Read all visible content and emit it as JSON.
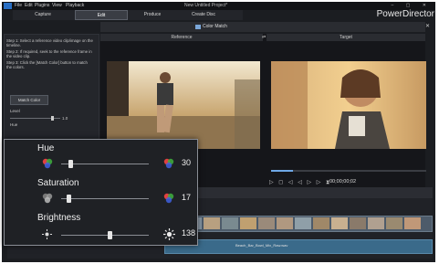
{
  "window": {
    "title": "New Untitled Project*",
    "brand": "PowerDirector",
    "controls": "– ▢ ✕"
  },
  "menu": [
    "File",
    "Edit",
    "Plugins",
    "View",
    "Playback"
  ],
  "tabs": [
    "Capture",
    "Edit",
    "Produce",
    "Create Disc"
  ],
  "dialog": {
    "title": "Color Match",
    "close": "✕"
  },
  "left_panel": {
    "step1": "Step 1: Select a reference video clip/image on the timeline.",
    "step2": "Step 2: If required, seek to the reference frame in the video clip.",
    "step3": "Step 3: Click the [Match Color] button to match the colors.",
    "match_button": "Match Color",
    "level_label": "Level",
    "level_value": "1.0",
    "hue_label": "Hue",
    "saturation_label": "Saturation",
    "brightness_label": "Brightness"
  },
  "panes": {
    "reference": "Reference",
    "target": "Target"
  },
  "playback": {
    "buttons": "▷ ◻ ◁ ◁ ▷ ▷ ⧗",
    "timecode": "00;00;00;02",
    "progress": 0.14
  },
  "audio_clip": "Beach_Bar_Bowl_Mix_Raw.wav",
  "popup": {
    "sliders": [
      {
        "label": "Hue",
        "value": "30",
        "position": 0.1,
        "icon": "color-wheel-icon"
      },
      {
        "label": "Saturation",
        "value": "17",
        "position": 0.08,
        "icon": "color-wheel-icon"
      },
      {
        "label": "Brightness",
        "value": "138",
        "position": 0.55,
        "icon": "sun-icon"
      }
    ]
  },
  "colors": {
    "accent": "#2a6fc4",
    "panel": "#1f2125",
    "audio": "#3a6a8a"
  }
}
